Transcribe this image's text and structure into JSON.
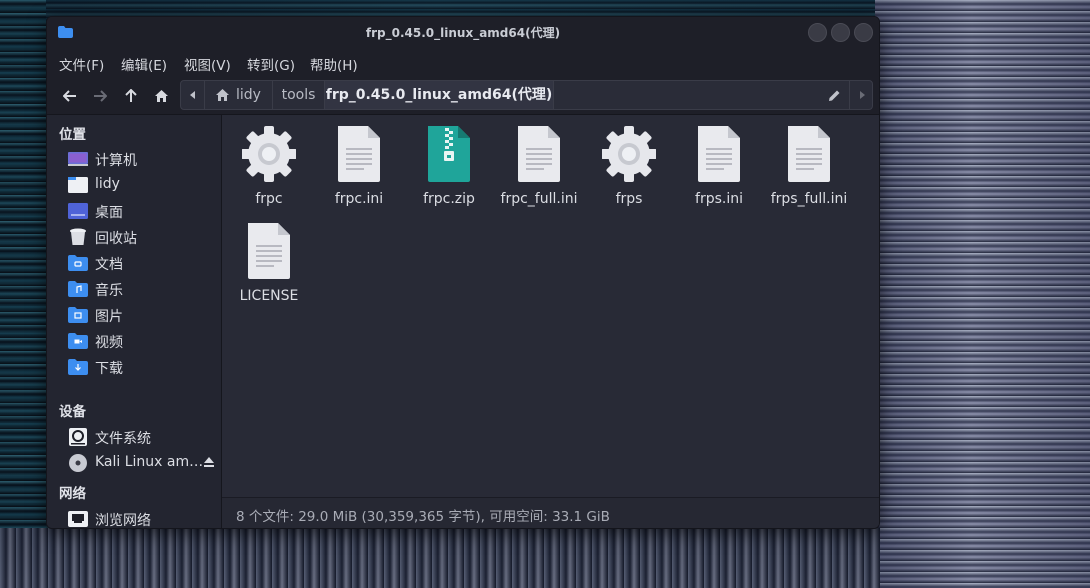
{
  "window": {
    "title": "frp_0.45.0_linux_amd64(代理)"
  },
  "menu": {
    "items": [
      "文件(F)",
      "编辑(E)",
      "视图(V)",
      "转到(G)",
      "帮助(H)"
    ]
  },
  "toolbar": {
    "breadcrumbs": [
      "lidy",
      "tools",
      "frp_0.45.0_linux_amd64(代理)"
    ]
  },
  "sidebar": {
    "places_header": "位置",
    "places": [
      {
        "label": "计算机",
        "icon": "computer-icon"
      },
      {
        "label": "lidy",
        "icon": "home-folder-icon"
      },
      {
        "label": "桌面",
        "icon": "desktop-icon"
      },
      {
        "label": "回收站",
        "icon": "trash-icon"
      },
      {
        "label": "文档",
        "icon": "documents-folder-icon"
      },
      {
        "label": "音乐",
        "icon": "music-folder-icon"
      },
      {
        "label": "图片",
        "icon": "pictures-folder-icon"
      },
      {
        "label": "视频",
        "icon": "videos-folder-icon"
      },
      {
        "label": "下载",
        "icon": "downloads-folder-icon"
      }
    ],
    "devices_header": "设备",
    "devices": [
      {
        "label": "文件系统",
        "icon": "harddisk-icon"
      },
      {
        "label": "Kali Linux am…",
        "icon": "optical-disc-icon"
      }
    ],
    "network_header": "网络",
    "network": [
      {
        "label": "浏览网络",
        "icon": "network-icon"
      }
    ]
  },
  "files": [
    {
      "name": "frpc",
      "icon": "executable-gear-icon"
    },
    {
      "name": "frpc.ini",
      "icon": "text-file-icon"
    },
    {
      "name": "frpc.zip",
      "icon": "zip-archive-icon"
    },
    {
      "name": "frpc_full.ini",
      "icon": "text-file-icon"
    },
    {
      "name": "frps",
      "icon": "executable-gear-icon"
    },
    {
      "name": "frps.ini",
      "icon": "text-file-icon"
    },
    {
      "name": "frps_full.ini",
      "icon": "text-file-icon"
    },
    {
      "name": "LICENSE",
      "icon": "text-file-icon"
    }
  ],
  "status": {
    "text": "8 个文件: 29.0 MiB (30,359,365 字节), 可用空间: 33.1 GiB"
  },
  "colors": {
    "window_bg": "#282a36",
    "titlebar_bg": "#1e1f28",
    "sidebar_bg": "#232530",
    "folder_blue": "#3d8ef0",
    "zip_teal": "#1fa59a"
  }
}
